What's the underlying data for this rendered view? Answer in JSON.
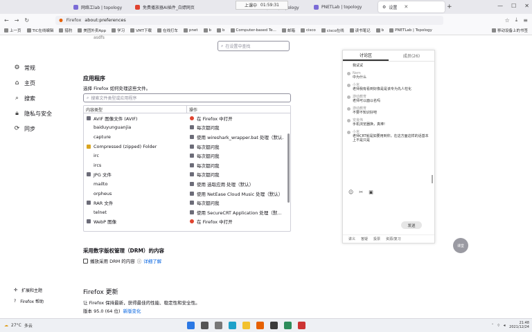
{
  "tabs": [
    {
      "label": "网络工lab | topology",
      "active": false
    },
    {
      "label": "免费播放器AI插件_白嫖网页",
      "active": false
    },
    {
      "label": "学网络 | Lab | topology",
      "active": false
    },
    {
      "label": "PNETLab | topology",
      "active": false
    },
    {
      "label": "设置",
      "active": true
    }
  ],
  "timebar": {
    "label": "上课中",
    "time": "01:59:31"
  },
  "address": {
    "brand": "Firefox",
    "url": "about:preferences"
  },
  "bookmarks": [
    "上一页",
    "TIC在线编辑",
    "猎豹",
    "美团外卖App",
    "学习",
    "VMT下载",
    "在线打车",
    "pnet",
    "b",
    "b",
    "Computer-based Te...",
    "邮箱",
    "cisco",
    "cisco在线",
    "读书笔记",
    "b",
    "PNETLab | Topology"
  ],
  "other_bookmarks": "移动设备上的书签",
  "search": {
    "placeholder": "在设置中查找"
  },
  "sidebar": {
    "items": [
      {
        "icon": "gear-icon",
        "label": "常规"
      },
      {
        "icon": "home-icon",
        "label": "主页"
      },
      {
        "icon": "search-icon",
        "label": "搜索"
      },
      {
        "icon": "lock-icon",
        "label": "隐私与安全"
      },
      {
        "icon": "sync-icon",
        "label": "同步"
      }
    ],
    "bottom": [
      {
        "icon": "puzzle-icon",
        "label": "扩展和主题"
      },
      {
        "icon": "help-icon",
        "label": "Firefox 帮助"
      }
    ]
  },
  "applications": {
    "title": "应用程序",
    "description": "选择 Firefox 如何处理这些文件。",
    "filter_placeholder": "搜索文件类型或应用程序",
    "col_type": "内容类型",
    "col_action": "操作",
    "partial_top": "asdfs",
    "rows": [
      {
        "type": "AVIF 图像文件 (AVIF)",
        "action": "在 Firefox 中打开",
        "tcolor": "#6c6c78",
        "acolor": "#e0432f"
      },
      {
        "type": "baiduyunguanjia",
        "action": "每次都问我",
        "tcolor": "",
        "acolor": "#6c6c78"
      },
      {
        "type": "capture",
        "action": "使用 wireshark_wrapper.bat 处理（默认...",
        "tcolor": "",
        "acolor": "#6c6c78"
      },
      {
        "type": "Compressed (zipped) Folder",
        "action": "每次都问我",
        "tcolor": "#d9a520",
        "acolor": "#6c6c78"
      },
      {
        "type": "irc",
        "action": "每次都问我",
        "tcolor": "",
        "acolor": "#6c6c78"
      },
      {
        "type": "ircs",
        "action": "每次都问我",
        "tcolor": "",
        "acolor": "#6c6c78"
      },
      {
        "type": "JPG 文件",
        "action": "每次都问我",
        "tcolor": "#6c6c78",
        "acolor": "#6c6c78"
      },
      {
        "type": "mailto",
        "action": "使用 选取应用 处理（默认）",
        "tcolor": "",
        "acolor": "#6c6c78"
      },
      {
        "type": "orpheus",
        "action": "使用 NetEase Cloud Music 处理（默认）",
        "tcolor": "",
        "acolor": "#6c6c78"
      },
      {
        "type": "RAR 文件",
        "action": "每次都问我",
        "tcolor": "#6c6c78",
        "acolor": "#6c6c78"
      },
      {
        "type": "telnet",
        "action": "使用 SecureCRT Application 处理（默...",
        "tcolor": "",
        "acolor": "#6c6c78"
      },
      {
        "type": "WebP 图像",
        "action": "在 Firefox 中打开",
        "tcolor": "#6c6c78",
        "acolor": "#e0432f"
      }
    ]
  },
  "drm": {
    "title": "采用数字版权管理（DRM）的内容",
    "checkbox_label": "播放采用 DRM 的内容",
    "learn_more": "详细了解"
  },
  "updates": {
    "title": "Firefox 更新",
    "description": "让 Firefox 保持最新，获得最佳的性能、稳定性和安全性。",
    "version": "版本 95.0 (64 位)",
    "whats_new": "新版变化"
  },
  "chat": {
    "tabs": [
      "讨论区",
      "成员(26)"
    ],
    "messages": [
      {
        "who": "",
        "text": "我试试"
      },
      {
        "who": "Nem",
        "text": "中为什么"
      },
      {
        "who": "小米",
        "text": "老师我有看到好像是是该专为先人柱化"
      },
      {
        "who": "游动教育",
        "text": "老师可以面以名吗"
      },
      {
        "who": "游动教育",
        "text": "不要不知识好吧"
      },
      {
        "who": "安良伟",
        "text": "手机浏览器换，真棒!"
      },
      {
        "who": "小米",
        "text": "老师CRT就是如要用到你，在这方面这样的话基本上不是只是"
      }
    ],
    "send": "发送",
    "footer": [
      "讲义",
      "答疑",
      "投票",
      "资源/复习"
    ]
  },
  "float_bubble": "课堂",
  "taskbar": {
    "weather_temp": "27°C",
    "weather_desc": "多云",
    "time": "21:48",
    "date": "2021/12/24"
  }
}
